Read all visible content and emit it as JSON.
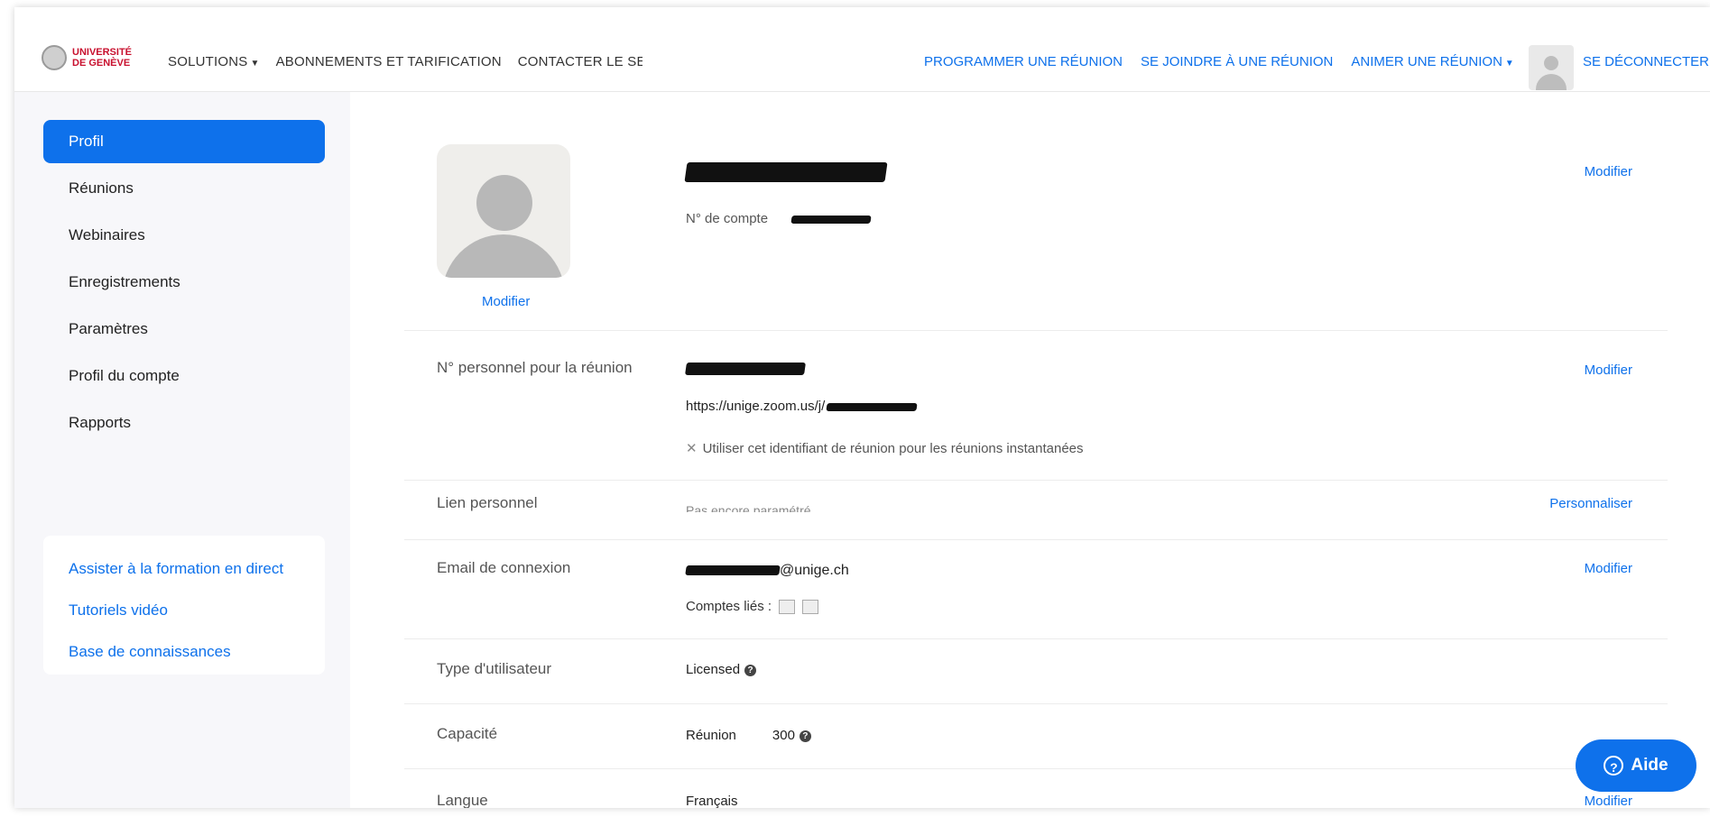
{
  "brand": {
    "line1": "UNIVERSITÉ",
    "line2": "DE GENÈVE",
    "color": "#c8102e"
  },
  "topnav": {
    "left": [
      "SOLUTIONS",
      "ABONNEMENTS ET TARIFICATION",
      "CONTACTER LE SERVICE COMMERCIAL"
    ],
    "right": [
      "PROGRAMMER UNE RÉUNION",
      "SE JOINDRE À UNE RÉUNION",
      "ANIMER UNE RÉUNION"
    ],
    "logout": "SE DÉCONNECTER",
    "accent": "#0e71eb"
  },
  "sidebar": {
    "items": [
      "Profil",
      "Réunions",
      "Webinaires",
      "Enregistrements",
      "Paramètres",
      "Profil du compte",
      "Rapports"
    ],
    "active": "Profil",
    "help_links": [
      "Assister à la formation en direct",
      "Tutoriels vidéo",
      "Base de connaissances"
    ]
  },
  "profile": {
    "avatar_edit": "Modifier",
    "account_label": "N° de compte",
    "edit_label": "Modifier"
  },
  "rows": {
    "pmi_label": "N° personnel pour la réunion",
    "pmi_url": "https://unige.zoom.us/j/",
    "pmi_option": "Utiliser cet identifiant de réunion pour les réunions instantanées",
    "link_label": "Lien personnel",
    "link_value": "Pas encore paramétré",
    "link_action": "Personnaliser",
    "email_label": "Email de connexion",
    "email_domain": "@unige.ch",
    "linked_label": "Comptes liés :",
    "user_type_label": "Type d'utilisateur",
    "user_type_value": "Licensed",
    "capacity_label": "Capacité",
    "capacity_kind": "Réunion",
    "capacity_value": "300",
    "language_label": "Langue",
    "language_value": "Français",
    "language_action": "Modifier"
  },
  "help_button": "Aide"
}
